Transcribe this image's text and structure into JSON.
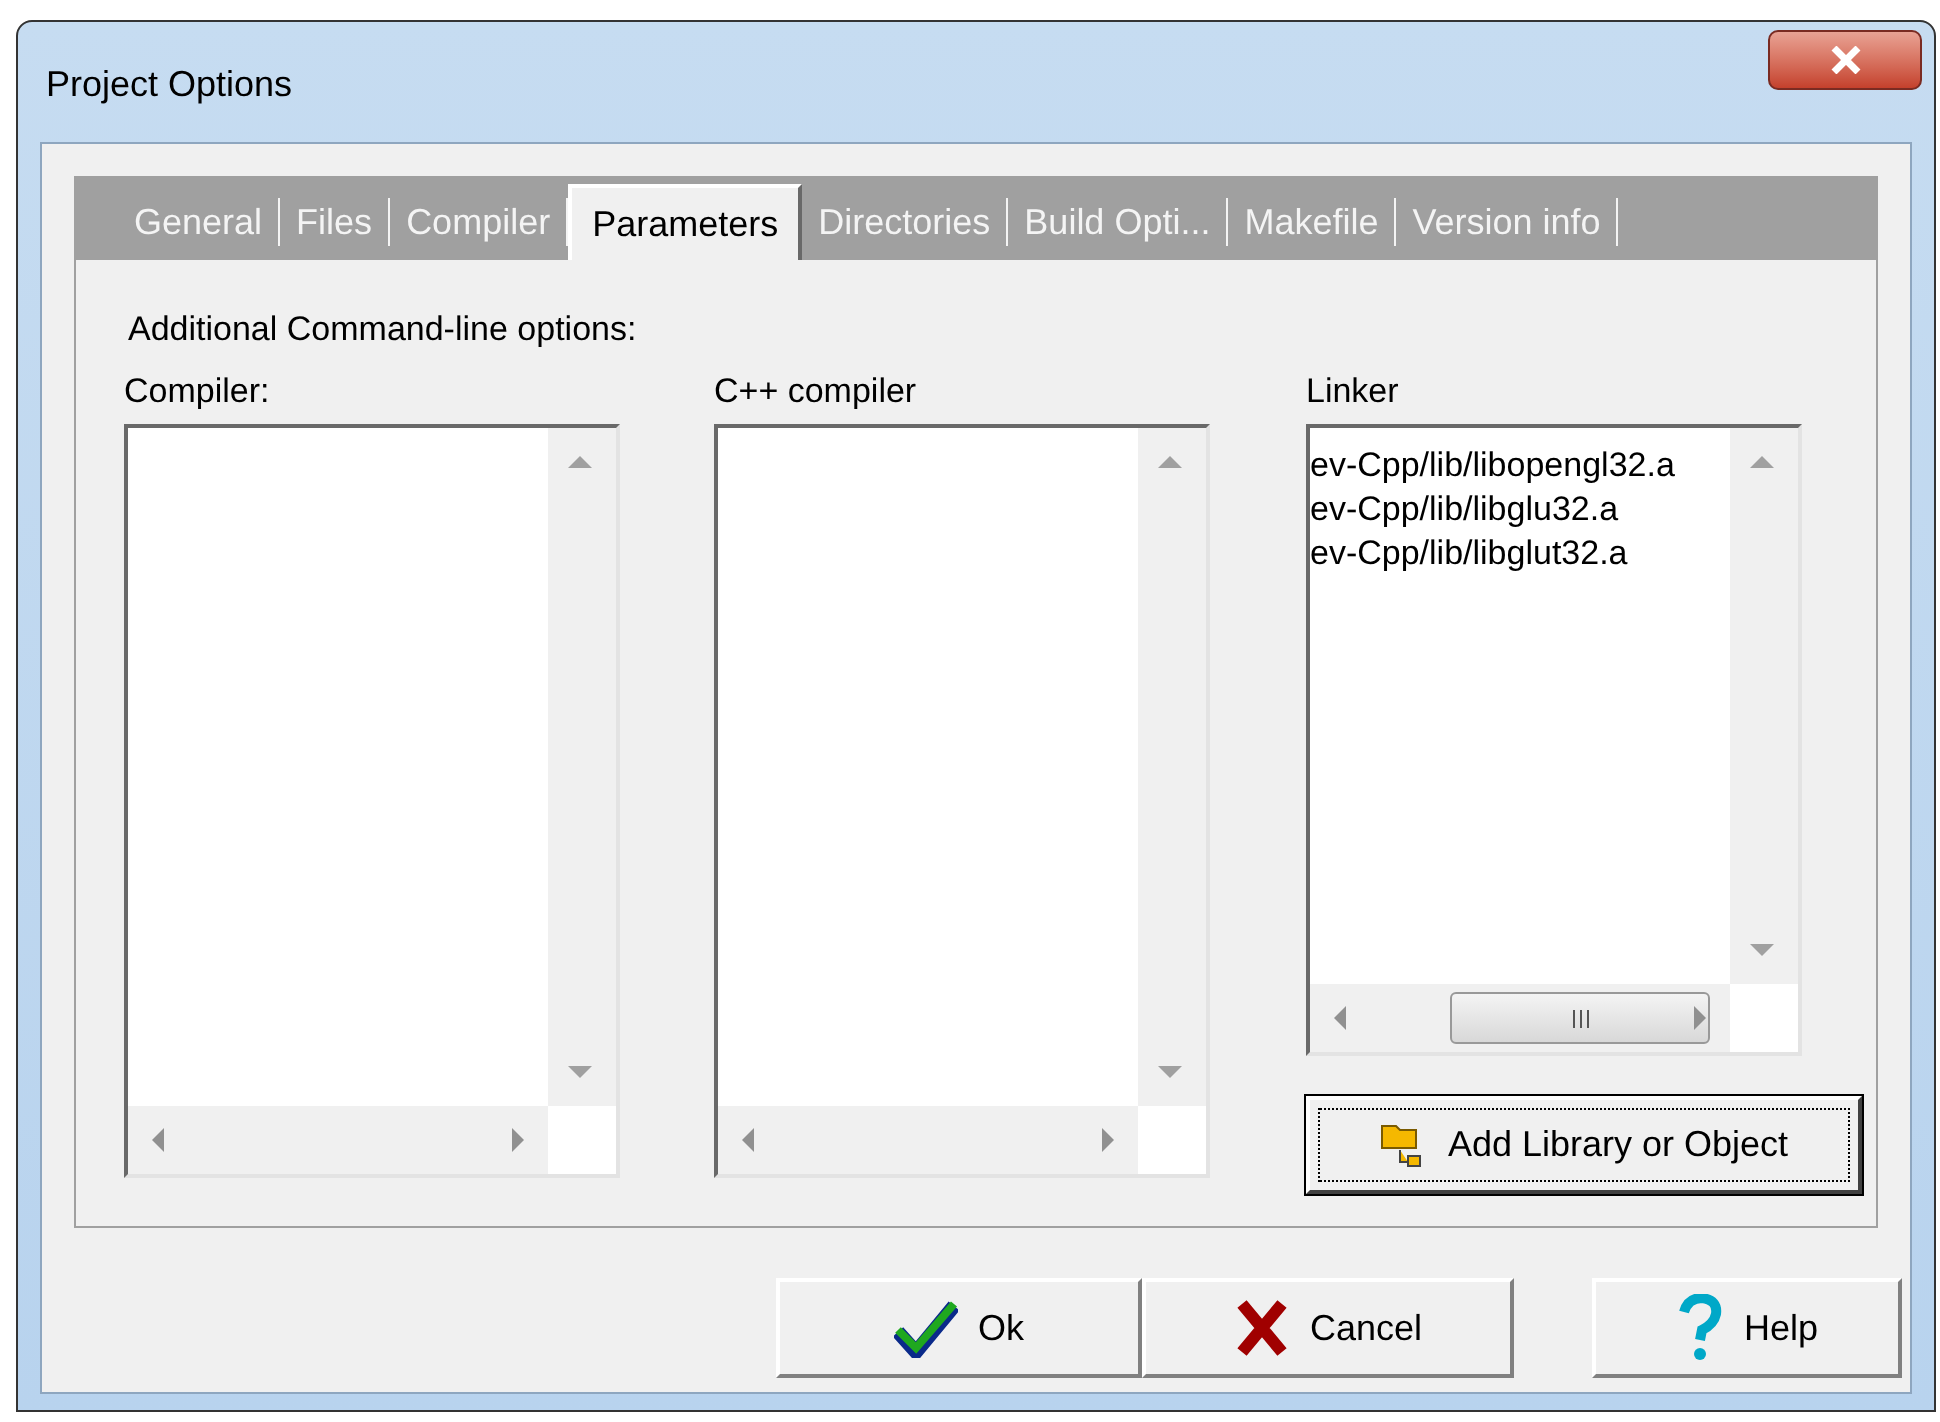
{
  "window": {
    "title": "Project Options"
  },
  "tabs": [
    {
      "label": "General",
      "selected": false
    },
    {
      "label": "Files",
      "selected": false
    },
    {
      "label": "Compiler",
      "selected": false
    },
    {
      "label": "Parameters",
      "selected": true
    },
    {
      "label": "Directories",
      "selected": false
    },
    {
      "label": "Build Opti...",
      "selected": false
    },
    {
      "label": "Makefile",
      "selected": false
    },
    {
      "label": "Version info",
      "selected": false
    }
  ],
  "section_label": "Additional Command-line options:",
  "lists": [
    {
      "label": "Compiler:"
    },
    {
      "label": "C++ compiler"
    },
    {
      "label": "Linker",
      "items": [
        "ev-Cpp/lib/libopengl32.a",
        "ev-Cpp/lib/libglu32.a",
        "ev-Cpp/lib/libglut32.a"
      ]
    }
  ],
  "add_button": "Add Library or Object",
  "buttons": [
    {
      "kind": "ok",
      "label": "Ok"
    },
    {
      "kind": "cancel",
      "label": "Cancel"
    },
    {
      "kind": "help",
      "label": "Help"
    }
  ]
}
